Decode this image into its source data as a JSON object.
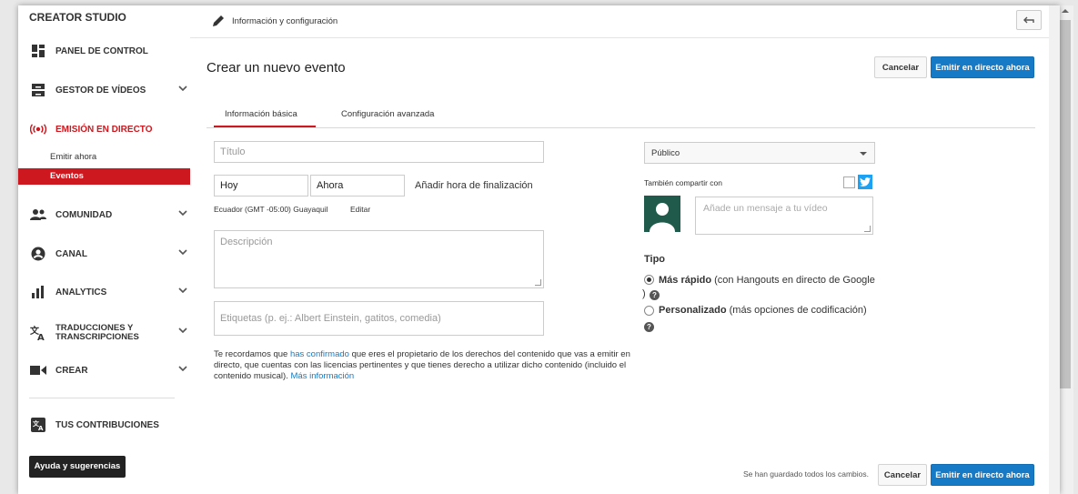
{
  "sidebar": {
    "title": "CREATOR STUDIO",
    "items": [
      {
        "label": "PANEL DE CONTROL",
        "icon": "dashboard-icon"
      },
      {
        "label": "GESTOR DE VÍDEOS",
        "icon": "video-manager-icon"
      },
      {
        "label": "EMISIÓN EN DIRECTO",
        "icon": "live-broadcast-icon"
      },
      {
        "label": "COMUNIDAD",
        "icon": "community-icon"
      },
      {
        "label": "CANAL",
        "icon": "channel-icon"
      },
      {
        "label": "ANALYTICS",
        "icon": "analytics-icon"
      },
      {
        "label": "TRADUCCIONES Y TRANSCRIPCIONES",
        "icon": "translate-icon"
      },
      {
        "label": "CREAR",
        "icon": "create-icon"
      },
      {
        "label": "TUS CONTRIBUCIONES",
        "icon": "contributions-icon"
      }
    ],
    "subitems": [
      {
        "label": "Emitir ahora"
      },
      {
        "label": "Eventos"
      }
    ],
    "help_button": "Ayuda y sugerencias"
  },
  "header": {
    "title": "Información y configuración"
  },
  "page": {
    "title": "Crear un nuevo evento",
    "cancel": "Cancelar",
    "go_live": "Emitir en directo ahora"
  },
  "tabs": [
    {
      "label": "Información básica"
    },
    {
      "label": "Configuración avanzada"
    }
  ],
  "form": {
    "title_placeholder": "Título",
    "date_value": "Hoy",
    "time_value": "Ahora",
    "add_end_time": "Añadir hora de finalización",
    "timezone": "Ecuador (GMT -05:00) Guayaquil",
    "edit_link": "Editar",
    "description_placeholder": "Descripción",
    "tags_placeholder": "Etiquetas (p. ej.: Albert Einstein, gatitos, comedia)",
    "notice_part1": "Te recordamos que",
    "notice_link1": "has confirmado",
    "notice_part2": "que eres el propietario de los derechos del contenido que vas a emitir en directo, que cuentas con las licencias pertinentes y que tienes derecho a utilizar dicho contenido (incluido el contenido musical).",
    "notice_link2": "Más información"
  },
  "right": {
    "privacy": "Público",
    "share_label": "También compartir con",
    "message_placeholder": "Añade un mensaje a tu vídeo",
    "type_label": "Tipo",
    "option1_bold": "Más rápido",
    "option1_rest": "(con Hangouts en directo de Google",
    "option1_tail": ")",
    "option2_bold": "Personalizado",
    "option2_rest": "(más opciones de codificación)",
    "help_glyph": "?"
  },
  "footer": {
    "saved": "Se han guardado todos los cambios.",
    "cancel": "Cancelar",
    "go_live": "Emitir en directo ahora"
  },
  "colors": {
    "accent_red": "#cc181e",
    "primary_blue": "#167ac6",
    "twitter_blue": "#1da1f2"
  }
}
